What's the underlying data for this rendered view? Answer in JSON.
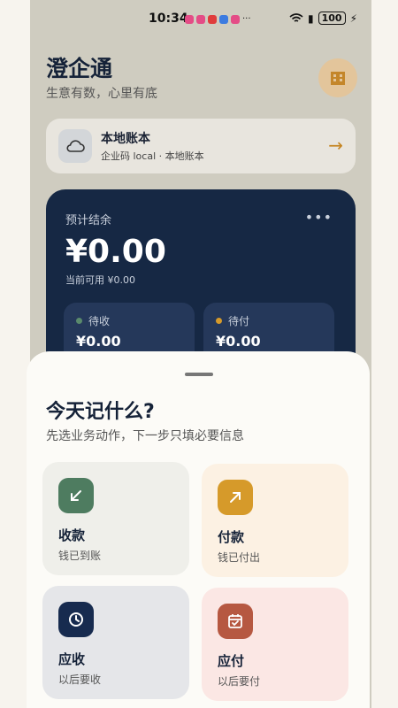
{
  "status_bar": {
    "time": "10:34",
    "battery": "100"
  },
  "header": {
    "title": "澄企通",
    "subtitle": "生意有数，心里有底"
  },
  "account": {
    "name": "本地账本",
    "meta": "企业码 local · 本地账本"
  },
  "balance": {
    "label": "预计结余",
    "more": "•••",
    "amount": "¥0.00",
    "available": "当前可用 ¥0.00",
    "receivable": {
      "label": "待收",
      "value": "¥0.00"
    },
    "payable": {
      "label": "待付",
      "value": "¥0.00"
    }
  },
  "sheet": {
    "title": "今天记什么?",
    "subtitle": "先选业务动作，下一步只填必要信息",
    "actions": [
      {
        "title": "收款",
        "subtitle": "钱已到账",
        "icon": "arrow-down-left-icon",
        "icon_color": "#4e7c60",
        "bg": "#efefea"
      },
      {
        "title": "付款",
        "subtitle": "钱已付出",
        "icon": "arrow-up-right-icon",
        "icon_color": "#d69a2a",
        "bg": "#fcf1e3"
      },
      {
        "title": "应收",
        "subtitle": "以后要收",
        "icon": "clock-icon",
        "icon_color": "#172b4f",
        "bg": "#e5e6e9"
      },
      {
        "title": "应付",
        "subtitle": "以后要付",
        "icon": "calendar-check-icon",
        "icon_color": "#b65841",
        "bg": "#fbe7e4"
      }
    ]
  },
  "colors": {
    "accent": "#c58522",
    "dark": "#162844"
  }
}
